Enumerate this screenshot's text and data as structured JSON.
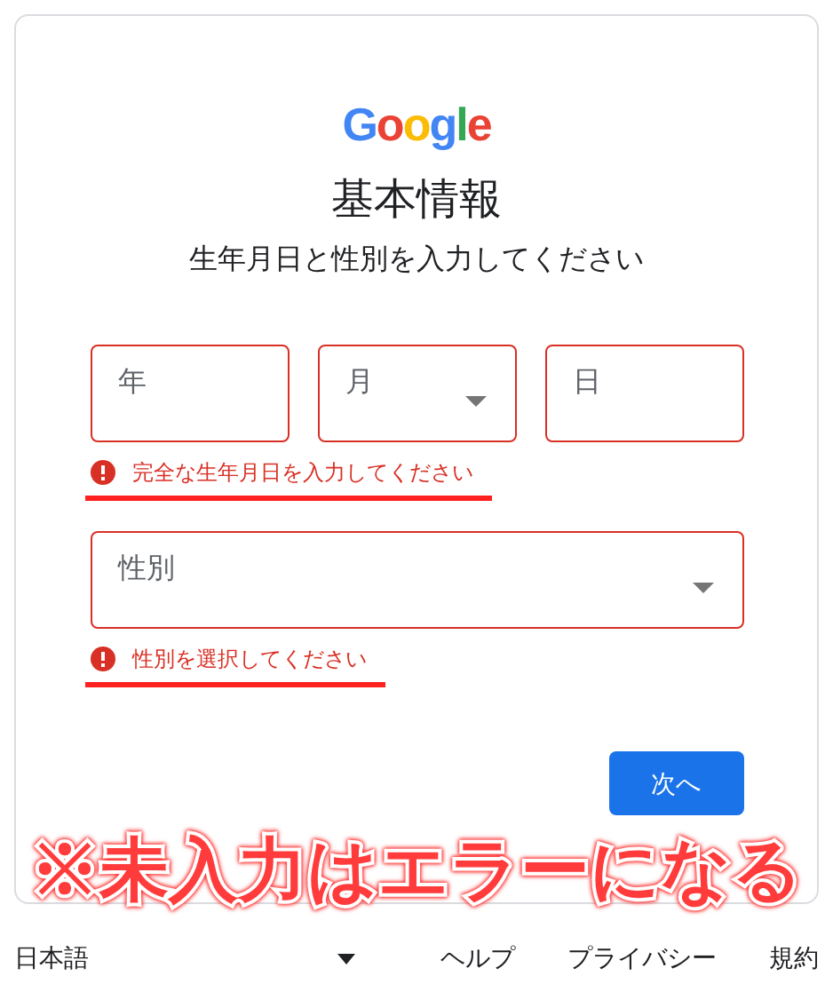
{
  "logo": "Google",
  "title": "基本情報",
  "subtitle": "生年月日と性別を入力してください",
  "date_fields": [
    {
      "kind": "text",
      "placeholder": "年",
      "error": true
    },
    {
      "kind": "dropdown",
      "placeholder": "月",
      "error": true
    },
    {
      "kind": "text",
      "placeholder": "日",
      "error": true
    }
  ],
  "date_error": {
    "text": "完全な生年月日を入力してください",
    "highlighted": true
  },
  "gender_field": {
    "kind": "dropdown",
    "placeholder": "性別",
    "error": true
  },
  "gender_error": {
    "text": "性別を選択してください",
    "highlighted": true
  },
  "next_button": "次へ",
  "annotation": "※未入力はエラーになる",
  "footer": {
    "language": "日本語",
    "links": [
      "ヘルプ",
      "プライバシー",
      "規約"
    ]
  }
}
